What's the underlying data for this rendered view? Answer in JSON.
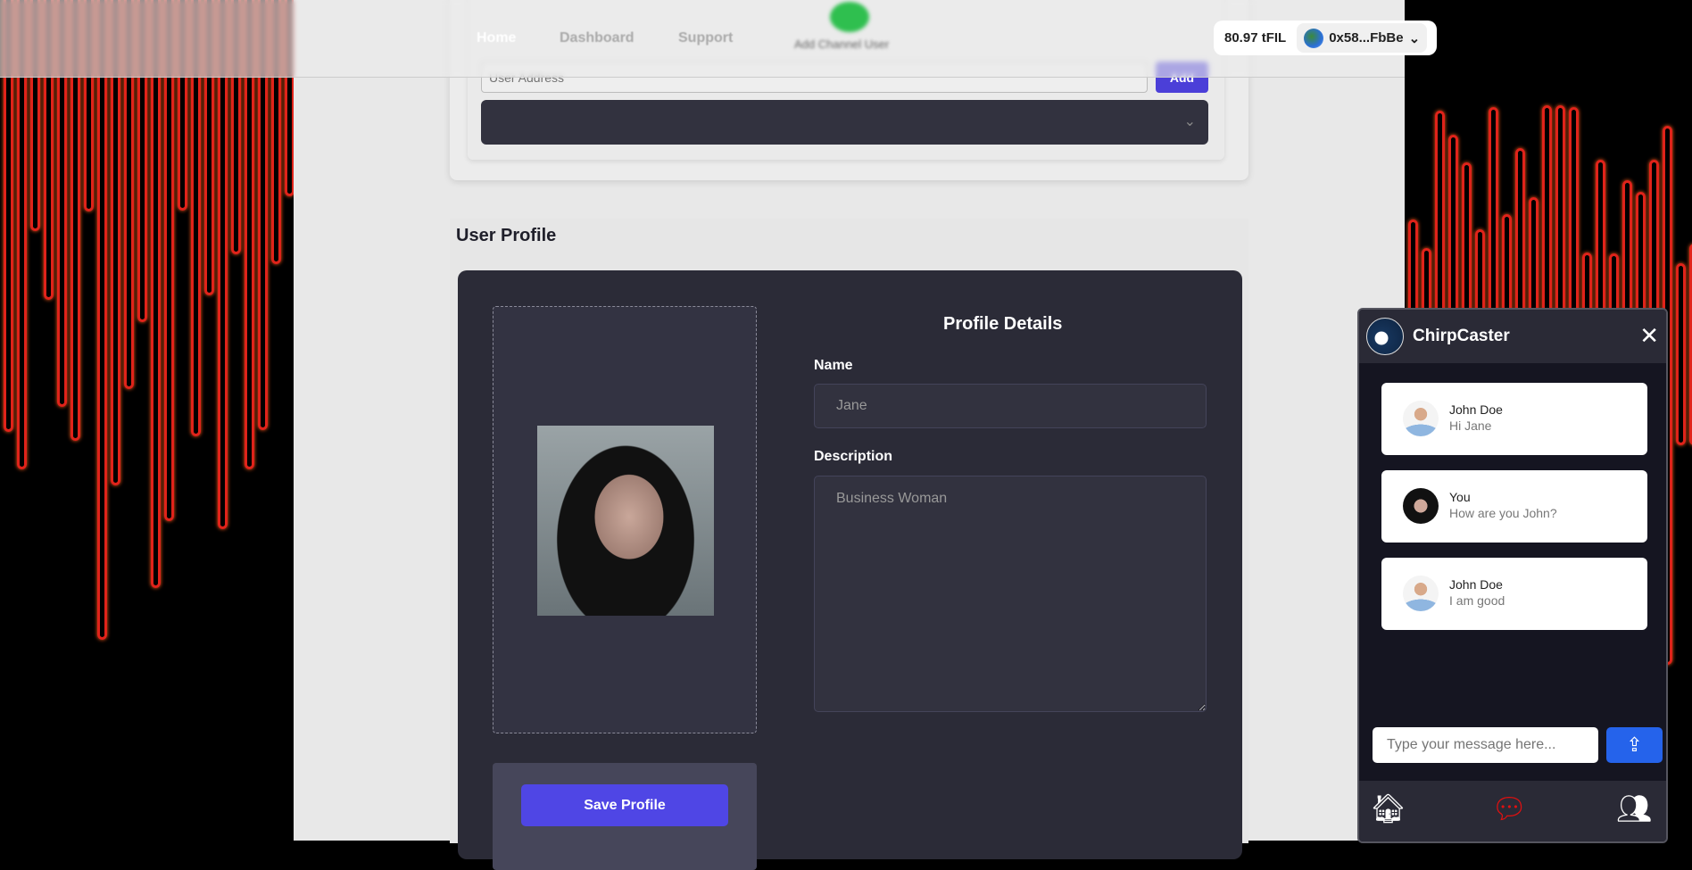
{
  "nav": {
    "links": [
      "Home",
      "Dashboard",
      "Support"
    ],
    "logo_label": "Add Channel User"
  },
  "wallet": {
    "balance": "80.97 tFIL",
    "account": "0x58...FbBe",
    "chevron": "⌄"
  },
  "channel_form": {
    "address_placeholder": "User Address",
    "add_label": "Add",
    "select_chevron": "⌄"
  },
  "profile": {
    "section_title": "User Profile",
    "details_title": "Profile Details",
    "name_label": "Name",
    "name_value": "Jane",
    "description_label": "Description",
    "description_value": "Business Woman",
    "save_label": "Save Profile"
  },
  "chat": {
    "title": "ChirpCaster",
    "close": "✕",
    "messages": [
      {
        "sender": "John Doe",
        "text": "Hi Jane",
        "avatar": "male"
      },
      {
        "sender": "You",
        "text": "How are you John?",
        "avatar": "female"
      },
      {
        "sender": "John Doe",
        "text": "I am good",
        "avatar": "male"
      }
    ],
    "input_placeholder": "Type your message here...",
    "send_icon": "upload-icon",
    "footer_icons": [
      "home-icon",
      "chat-bubbles-icon",
      "users-icon"
    ],
    "active_color": "#e01010"
  },
  "colors": {
    "accent": "#4f46e5",
    "send": "#2563eb",
    "panel": "#2b2b37"
  }
}
